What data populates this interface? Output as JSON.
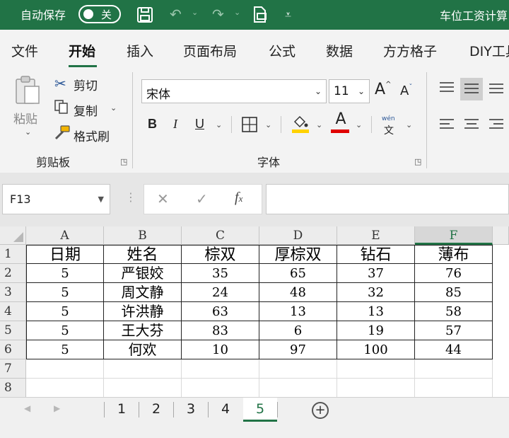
{
  "titlebar": {
    "autosave_label": "自动保存",
    "autosave_state": "关",
    "doc_title": "车位工资计算"
  },
  "tabs": [
    "文件",
    "开始",
    "插入",
    "页面布局",
    "公式",
    "数据",
    "方方格子",
    "DIY工具"
  ],
  "ribbon": {
    "clipboard": {
      "paste": "粘贴",
      "cut": "剪切",
      "copy": "复制",
      "format_painter": "格式刷",
      "group_label": "剪贴板"
    },
    "font": {
      "font_name": "宋体",
      "font_size": "11",
      "bold": "B",
      "italic": "I",
      "underline": "U",
      "grow": "A",
      "shrink": "A",
      "color_a": "A",
      "wen_top": "wén",
      "wen_bottom": "文",
      "group_label": "字体"
    }
  },
  "formula_bar": {
    "name_box": "F13",
    "formula": ""
  },
  "sheet": {
    "columns": [
      "A",
      "B",
      "C",
      "D",
      "E",
      "F"
    ],
    "selected_column": "F",
    "row_numbers": [
      "1",
      "2",
      "3",
      "4",
      "5",
      "6",
      "7",
      "8"
    ],
    "header_row": [
      "日期",
      "姓名",
      "棕双",
      "厚棕双",
      "钻石",
      "薄布"
    ],
    "rows": [
      [
        "5",
        "严银姣",
        "35",
        "65",
        "37",
        "76"
      ],
      [
        "5",
        "周文静",
        "24",
        "48",
        "32",
        "85"
      ],
      [
        "5",
        "许洪静",
        "63",
        "13",
        "13",
        "58"
      ],
      [
        "5",
        "王大芬",
        "83",
        "6",
        "19",
        "57"
      ],
      [
        "5",
        "何欢",
        "10",
        "97",
        "100",
        "44"
      ]
    ]
  },
  "sheet_tabs": {
    "tabs": [
      "1",
      "2",
      "3",
      "4",
      "5"
    ],
    "active": "5"
  },
  "colors": {
    "accent": "#217346",
    "highlight_yellow": "#ffd200",
    "font_red": "#e00000"
  }
}
